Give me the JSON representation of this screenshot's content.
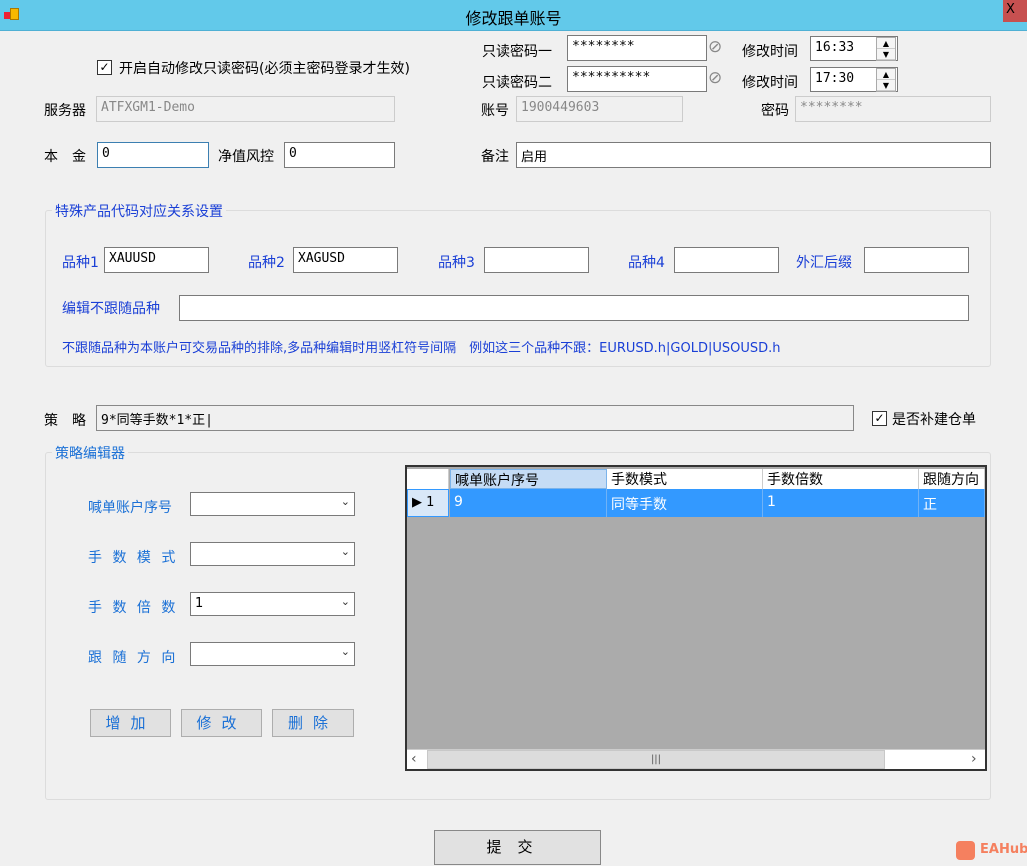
{
  "window": {
    "title": "修改跟单账号",
    "close": "X"
  },
  "auto_change": {
    "label": "开启自动修改只读密码(必须主密码登录才生效)",
    "checked": true
  },
  "ro_pwd1": {
    "label": "只读密码一",
    "value": "********",
    "time_label": "修改时间",
    "time": "16:33"
  },
  "ro_pwd2": {
    "label": "只读密码二",
    "value": "**********",
    "time_label": "修改时间",
    "time": "17:30"
  },
  "server": {
    "label": "服务器",
    "value": "ATFXGM1-Demo"
  },
  "account": {
    "label": "账号",
    "value": "1900449603"
  },
  "password": {
    "label": "密码",
    "value": "********"
  },
  "principal": {
    "label": "本　金",
    "value": "0"
  },
  "equity_risk": {
    "label": "净值风控",
    "value": "0"
  },
  "remark": {
    "label": "备注",
    "value": "启用"
  },
  "special": {
    "title": "特殊产品代码对应关系设置",
    "symbols": [
      {
        "label": "品种1",
        "value": "XAUUSD"
      },
      {
        "label": "品种2",
        "value": "XAGUSD"
      },
      {
        "label": "品种3",
        "value": ""
      },
      {
        "label": "品种4",
        "value": ""
      }
    ],
    "fx_suffix": {
      "label": "外汇后缀",
      "value": ""
    },
    "exclude": {
      "label": "编辑不跟随品种",
      "value": ""
    },
    "hint": "不跟随品种为本账户可交易品种的排除,多品种编辑时用竖杠符号间隔　例如这三个品种不跟：EURUSD.h|GOLD|USOUSD.h"
  },
  "strategy": {
    "label": "策　略",
    "value": "9*同等手数*1*正|",
    "reopen": {
      "label": "是否补建仓单",
      "checked": true
    }
  },
  "editor": {
    "title": "策略编辑器",
    "fields": [
      {
        "label": "喊单账户序号",
        "value": ""
      },
      {
        "label": "手 数 模 式",
        "value": ""
      },
      {
        "label": "手 数 倍 数",
        "value": "1"
      },
      {
        "label": "跟 随 方 向",
        "value": ""
      }
    ],
    "buttons": {
      "add": "增加",
      "edit": "修改",
      "delete": "删除"
    },
    "grid": {
      "columns": [
        "喊单账户序号",
        "手数模式",
        "手数倍数",
        "跟随方向"
      ],
      "rows": [
        {
          "index": "1",
          "cells": [
            "9",
            "同等手数",
            "1",
            "正"
          ]
        }
      ]
    }
  },
  "submit": "提交",
  "watermark": "EAHub"
}
